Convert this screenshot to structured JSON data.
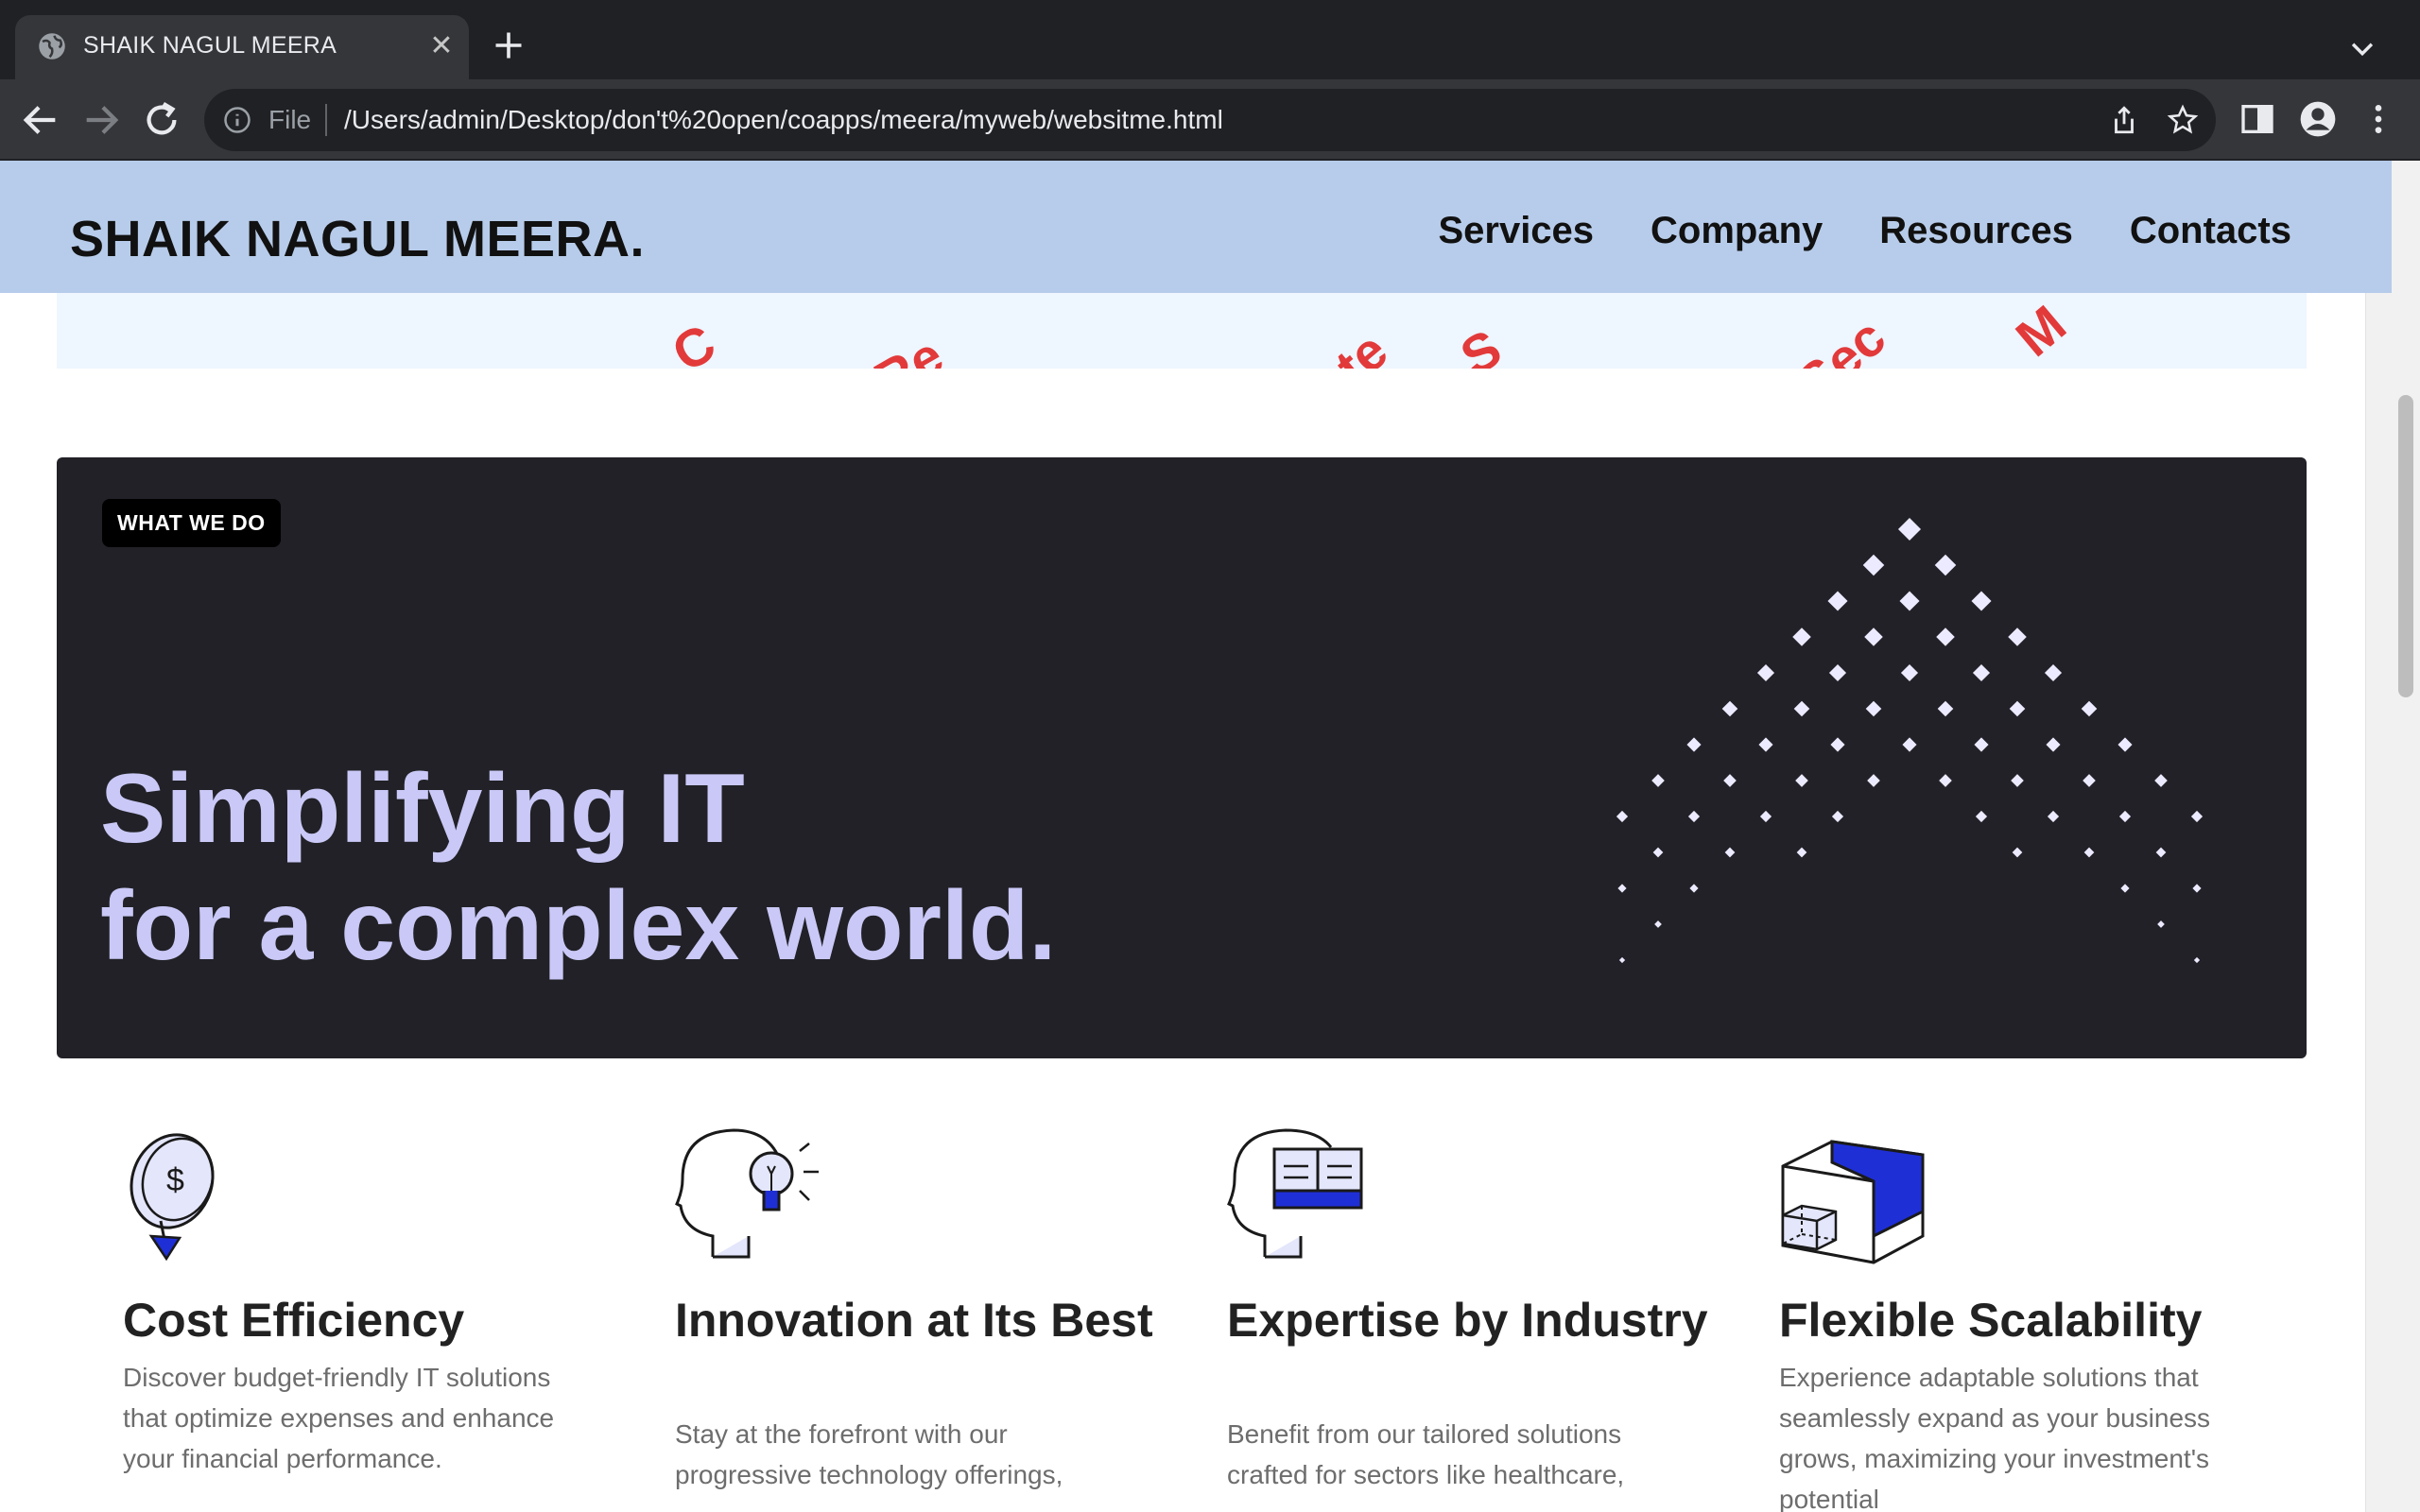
{
  "browser": {
    "tab_title": "SHAIK NAGUL MEERA",
    "url_scheme": "File",
    "url": "/Users/admin/Desktop/don't%20open/coapps/meera/myweb/websitme.html"
  },
  "header": {
    "logo": "SHAIK NAGUL MEERA.",
    "nav": [
      "Services",
      "Company",
      "Resources",
      "Contacts"
    ]
  },
  "ticker": {
    "fragments": [
      "C",
      "al Re",
      "ente",
      "S",
      "r Sec",
      "M"
    ]
  },
  "hero": {
    "badge": "WHAT WE DO",
    "title_line1": "Simplifying IT",
    "title_line2": "for a complex world."
  },
  "features": [
    {
      "icon": "dollar-coin-down-icon",
      "title": "Cost Efficiency",
      "desc": "Discover budget-friendly IT solutions that optimize expenses and enhance your financial performance."
    },
    {
      "icon": "lightbulb-head-icon",
      "title": "Innovation at Its Best",
      "desc": "Stay at the forefront with our progressive technology offerings,"
    },
    {
      "icon": "book-head-icon",
      "title": "Expertise by Industry",
      "desc": "Benefit from our tailored solutions crafted for sectors like healthcare,"
    },
    {
      "icon": "scalable-cube-icon",
      "title": "Flexible Scalability",
      "desc": "Experience adaptable solutions that seamlessly expand as your business grows, maximizing your investment's potential"
    }
  ],
  "colors": {
    "header_bg": "#b7ccea",
    "hero_bg": "#212127",
    "hero_title": "#c9c8f6",
    "ticker_text": "#e23a3a",
    "icon_accent": "#1f2fd6"
  }
}
